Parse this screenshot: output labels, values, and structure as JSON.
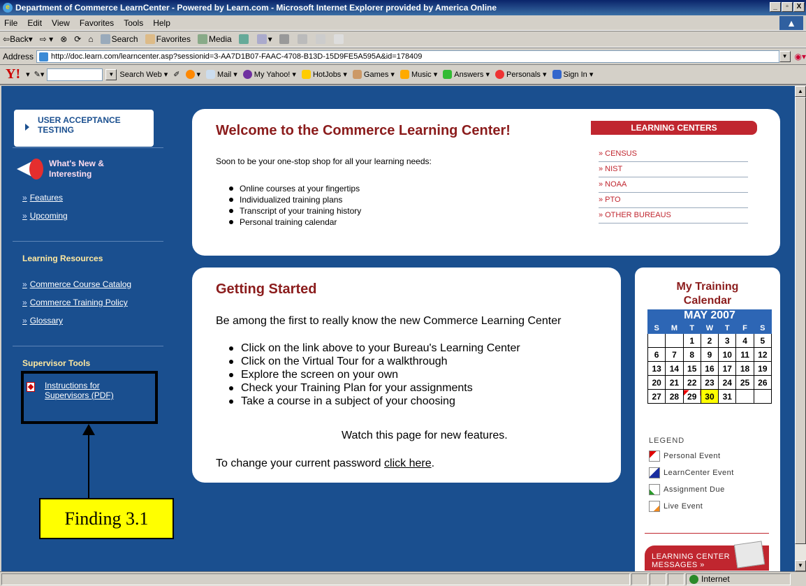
{
  "window": {
    "title": "Department of Commerce LearnCenter - Powered by Learn.com - Microsoft Internet Explorer provided by America Online",
    "min": "_",
    "max": "▫",
    "close": "X"
  },
  "menu": [
    "File",
    "Edit",
    "View",
    "Favorites",
    "Tools",
    "Help"
  ],
  "toolbar": {
    "back": "Back",
    "search": "Search",
    "favorites": "Favorites",
    "media": "Media"
  },
  "address": {
    "label": "Address",
    "url": "http://doc.learn.com/learncenter.asp?sessionid=3-AA7D1B07-FAAC-4708-B13D-15D9FE5A595A&id=178409"
  },
  "yahoo_bar": {
    "logo": "Y!",
    "search_web": "Search Web",
    "items": [
      "Mail",
      "My Yahoo!",
      "HotJobs",
      "Games",
      "Music",
      "Answers",
      "Personals",
      "Sign In"
    ]
  },
  "left_nav": {
    "uat": "USER ACCEPTANCE TESTING",
    "whats_new": "What's New & Interesting",
    "whats_new_links": [
      "Features",
      "Upcoming"
    ],
    "learning_resources_heading": "Learning Resources",
    "learning_resources_links": [
      "Commerce Course Catalog",
      "Commerce Training Policy",
      "Glossary"
    ],
    "supervisor_heading": "Supervisor Tools",
    "supervisor_link": "Instructions for Supervisors (PDF)",
    "raquo": "»"
  },
  "annotation": {
    "label": "Finding 3.1"
  },
  "welcome": {
    "title": "Welcome to the Commerce Learning Center!",
    "subtitle": "Soon to be your one-stop shop for all your learning needs:",
    "bullets": [
      "Online courses at your fingertips",
      "Individualized training plans",
      "Transcript of your training history",
      "Personal training calendar"
    ]
  },
  "learning_centers": {
    "heading": "LEARNING CENTERS",
    "items": [
      "CENSUS",
      "NIST",
      "NOAA",
      "PTO",
      "OTHER BUREAUS"
    ]
  },
  "getting_started": {
    "title": "Getting Started",
    "intro": "Be among the first to really know the new Commerce Learning Center",
    "bullets": [
      "Click on the link above to your Bureau's Learning Center",
      "Click on the Virtual Tour for a walkthrough",
      "Explore the screen on your own",
      "Check your Training Plan for your assignments",
      "Take a course in a subject of your choosing"
    ],
    "watch": "Watch this page for new features.",
    "password_text": "To change your current password ",
    "password_link": "click here",
    "password_end": "."
  },
  "calendar": {
    "title": "My Training Calendar",
    "month": "MAY 2007",
    "days": [
      "S",
      "M",
      "T",
      "W",
      "T",
      "F",
      "S"
    ],
    "weeks": [
      [
        "",
        "",
        "1",
        "2",
        "3",
        "4",
        "5"
      ],
      [
        "6",
        "7",
        "8",
        "9",
        "10",
        "11",
        "12"
      ],
      [
        "13",
        "14",
        "15",
        "16",
        "17",
        "18",
        "19"
      ],
      [
        "20",
        "21",
        "22",
        "23",
        "24",
        "25",
        "26"
      ],
      [
        "27",
        "28",
        "29",
        "30",
        "31",
        "",
        ""
      ]
    ],
    "today": "30",
    "personal_event_day": "29",
    "legend_heading": "LEGEND",
    "legend": [
      {
        "label": "Personal Event",
        "color": "#e00000"
      },
      {
        "label": "LearnCenter Event",
        "color": "#1a2ea0"
      },
      {
        "label": "Assignment Due",
        "color": "#2a9a2a"
      },
      {
        "label": "Live Event",
        "color": "#f08a20"
      }
    ],
    "messages": "LEARNING CENTER MESSAGES »"
  },
  "status": {
    "zone": "Internet"
  },
  "colors": {
    "page_bg": "#1a4f8f",
    "accent_red": "#c0262f",
    "title_red": "#8b1c1c",
    "cal_blue": "#2d66b5"
  }
}
